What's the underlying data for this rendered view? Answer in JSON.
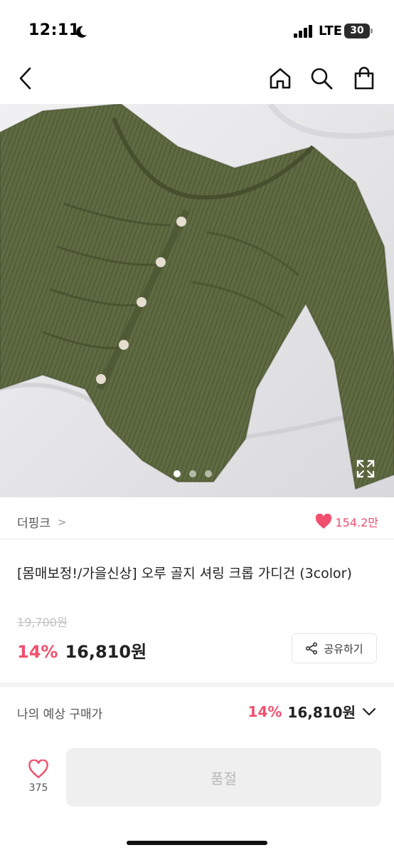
{
  "status_bar": {
    "time": "12:11",
    "network": "LTE",
    "battery": "30",
    "icons": [
      "moon-icon",
      "signal-icon",
      "battery-icon"
    ]
  },
  "nav": {
    "icons": [
      "chevron-left-icon",
      "home-icon",
      "search-icon",
      "shopping-bag-icon"
    ]
  },
  "gallery": {
    "current_index": 1,
    "total": 3,
    "icons": [
      "expand-icon"
    ]
  },
  "brand": {
    "name": "더핑크",
    "chevron": ">",
    "like_count": "154.2만",
    "icons": [
      "heart-filled-icon"
    ]
  },
  "product": {
    "title": "[몸매보정!/가을신상] 오루 골지 셔링 크롭 가디건 (3color)",
    "original_price": "19,700원",
    "discount_rate": "14%",
    "sale_price": "16,810원"
  },
  "share": {
    "label": "공유하기",
    "icon": "share-icon"
  },
  "expected_price": {
    "label": "나의 예상 구매가",
    "rate": "14%",
    "amount": "16,810원",
    "icon": "chevron-down-icon"
  },
  "bottom_bar": {
    "wish_count": "375",
    "sold_out_label": "품절",
    "icons": [
      "heart-outline-icon"
    ]
  },
  "colors": {
    "accent": "#f0506e",
    "text": "#222222",
    "muted": "#999999",
    "disabled_bg": "#efefef",
    "garment": "#5f6b42"
  }
}
